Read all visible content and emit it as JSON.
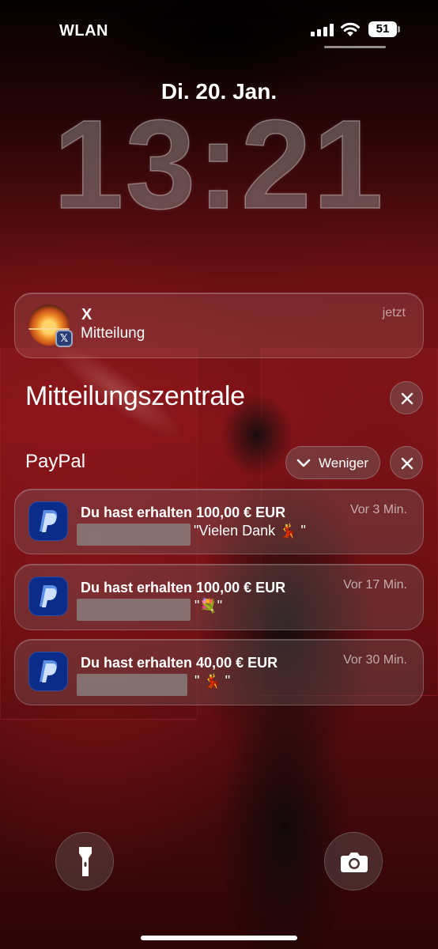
{
  "status_bar": {
    "carrier": "WLAN",
    "battery": "51",
    "signal_icon": "cellular-signal-icon",
    "wifi_icon": "wifi-icon"
  },
  "lock_screen": {
    "date": "Di. 20. Jan.",
    "time": "13:21"
  },
  "x_notification": {
    "app": "X",
    "body": "Mitteilung",
    "time": "jetzt"
  },
  "notification_center": {
    "title": "Mitteilungszentrale"
  },
  "paypal_group": {
    "title": "PayPal",
    "collapse_label": "Weniger",
    "notifications": [
      {
        "title": "Du hast erhalten 100,00 € EUR",
        "time": "Vor 3 Min.",
        "message": "\"Vielen Dank 💃 \""
      },
      {
        "title": "Du hast erhalten 100,00 € EUR",
        "time": "Vor 17 Min.",
        "message": "\"💐\""
      },
      {
        "title": "Du hast erhalten 40,00 € EUR",
        "time": "Vor 30 Min.",
        "message": "\" 💃 \""
      }
    ]
  },
  "colors": {
    "paypal_icon_bg": "#0c2c8a",
    "x_badge_bg": "#2a3e76"
  }
}
